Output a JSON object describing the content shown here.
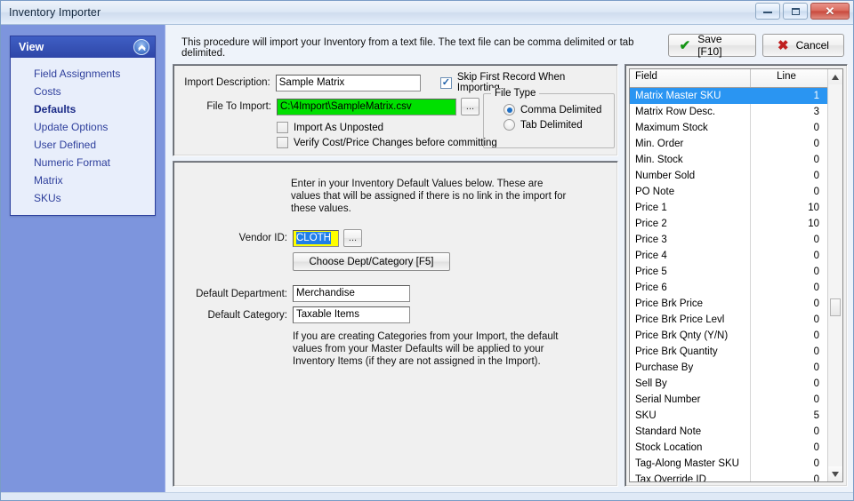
{
  "window": {
    "title": "Inventory Importer",
    "minimize_label": "Minimize",
    "maximize_label": "Restore",
    "close_label": "Close"
  },
  "sidebar": {
    "header": "View",
    "collapse_icon": "chevron-up-icon",
    "items": [
      {
        "label": "Field Assignments",
        "active": false
      },
      {
        "label": "Costs",
        "active": false
      },
      {
        "label": "Defaults",
        "active": true
      },
      {
        "label": "Update Options",
        "active": false
      },
      {
        "label": "User Defined",
        "active": false
      },
      {
        "label": "Numeric Format",
        "active": false
      },
      {
        "label": "Matrix",
        "active": false
      },
      {
        "label": "SKUs",
        "active": false
      }
    ]
  },
  "header": {
    "intro": "This procedure will import your Inventory from a text file.  The text file can be comma delimited or tab delimited.",
    "save_label": "Save [F10]",
    "save_icon": "check-icon",
    "cancel_label": "Cancel",
    "cancel_icon": "x-icon"
  },
  "import_panel": {
    "description_label": "Import Description:",
    "description_value": "Sample Matrix",
    "file_label": "File To Import:",
    "file_value": "C:\\4Import\\SampleMatrix.csv",
    "browse_label": "...",
    "skip_first_record_label": "Skip First Record When Importing",
    "skip_first_record_checked": true,
    "import_unposted_label": "Import As Unposted",
    "import_unposted_checked": false,
    "verify_changes_label": "Verify Cost/Price Changes before committing",
    "verify_changes_checked": false,
    "file_type": {
      "title": "File Type",
      "options": [
        {
          "label": "Comma Delimited",
          "selected": true
        },
        {
          "label": "Tab Delimited",
          "selected": false
        }
      ]
    }
  },
  "defaults_panel": {
    "intro_line1": "Enter in your Inventory Default Values below.  These are",
    "intro_line2": "values that will be assigned if there is no link in the import for",
    "intro_line3": "these values.",
    "vendor_label": "Vendor ID:",
    "vendor_value": "CLOTH",
    "vendor_browse_label": "...",
    "choose_dept_label": "Choose Dept/Category [F5]",
    "department_label": "Default Department:",
    "department_value": "Merchandise",
    "category_label": "Default Category:",
    "category_value": "Taxable Items",
    "note_line1": "If you are creating Categories from your Import, the default",
    "note_line2": "values from your Master Defaults will be applied to your",
    "note_line3": "Inventory Items (if they are not assigned in the Import)."
  },
  "grid": {
    "columns": [
      "Field",
      "Line"
    ],
    "rows": [
      {
        "field": "Matrix Master SKU",
        "line": "1",
        "selected": true
      },
      {
        "field": "Matrix Row Desc.",
        "line": "3",
        "selected": false
      },
      {
        "field": "Maximum Stock",
        "line": "0",
        "selected": false
      },
      {
        "field": "Min. Order",
        "line": "0",
        "selected": false
      },
      {
        "field": "Min. Stock",
        "line": "0",
        "selected": false
      },
      {
        "field": "Number Sold",
        "line": "0",
        "selected": false
      },
      {
        "field": "PO Note",
        "line": "0",
        "selected": false
      },
      {
        "field": "Price 1",
        "line": "10",
        "selected": false
      },
      {
        "field": "Price 2",
        "line": "10",
        "selected": false
      },
      {
        "field": "Price 3",
        "line": "0",
        "selected": false
      },
      {
        "field": "Price 4",
        "line": "0",
        "selected": false
      },
      {
        "field": "Price 5",
        "line": "0",
        "selected": false
      },
      {
        "field": "Price 6",
        "line": "0",
        "selected": false
      },
      {
        "field": "Price Brk Price",
        "line": "0",
        "selected": false
      },
      {
        "field": "Price Brk Price Levl",
        "line": "0",
        "selected": false
      },
      {
        "field": "Price Brk Qnty (Y/N)",
        "line": "0",
        "selected": false
      },
      {
        "field": "Price Brk Quantity",
        "line": "0",
        "selected": false
      },
      {
        "field": "Purchase By",
        "line": "0",
        "selected": false
      },
      {
        "field": "Sell By",
        "line": "0",
        "selected": false
      },
      {
        "field": "Serial Number",
        "line": "0",
        "selected": false
      },
      {
        "field": "SKU",
        "line": "5",
        "selected": false
      },
      {
        "field": "Standard Note",
        "line": "0",
        "selected": false
      },
      {
        "field": "Stock Location",
        "line": "0",
        "selected": false
      },
      {
        "field": "Tag-Along Master SKU",
        "line": "0",
        "selected": false
      },
      {
        "field": "Tax Override ID",
        "line": "0",
        "selected": false
      }
    ],
    "scroll_up_icon": "triangle-up-icon",
    "scroll_down_icon": "triangle-down-icon"
  },
  "colors": {
    "accent": "#2f46a8",
    "sidebar_bg": "#7d95dd",
    "selection": "#2a95f2",
    "file_field": "#00e000",
    "vendor_field": "#ffff00"
  }
}
